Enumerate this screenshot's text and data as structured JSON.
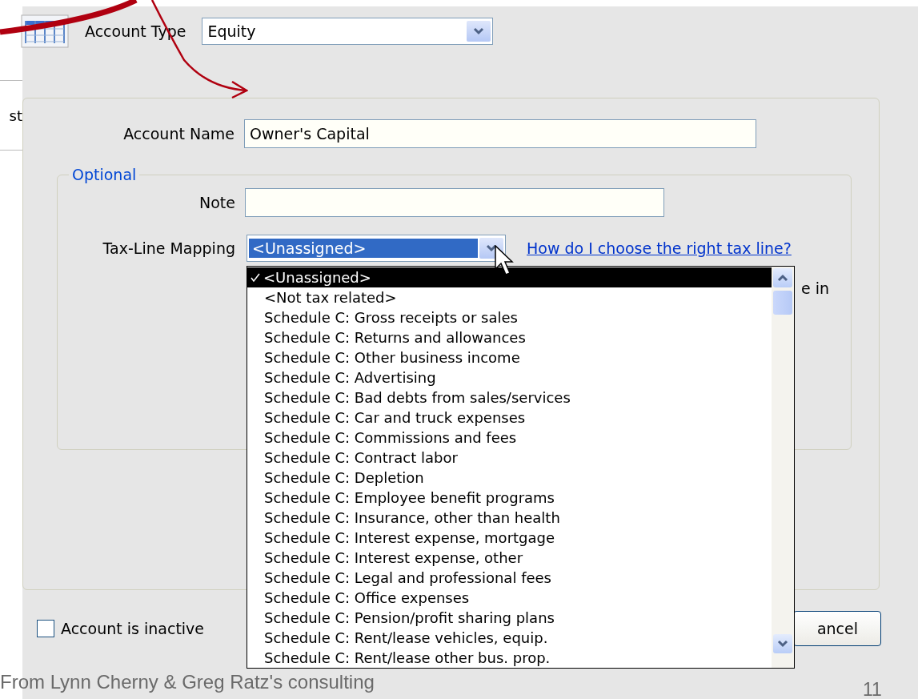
{
  "background_window": {
    "fragment": "st"
  },
  "account_type": {
    "label": "Account Type",
    "value": "Equity"
  },
  "account_name": {
    "label": "Account Name",
    "value": "Owner's Capital"
  },
  "optional": {
    "legend": "Optional",
    "note": {
      "label": "Note"
    },
    "tax_line": {
      "label": "Tax-Line Mapping",
      "value": "<Unassigned>",
      "expanded": true,
      "help_link": "How do I choose the right tax line?",
      "hidden_text": "e in"
    }
  },
  "tax_line_options": [
    {
      "label": "<Unassigned>",
      "selected": true
    },
    {
      "label": "<Not tax related>",
      "selected": false
    },
    {
      "label": "Schedule C: Gross receipts or sales",
      "selected": false
    },
    {
      "label": "Schedule C: Returns and allowances",
      "selected": false
    },
    {
      "label": "Schedule C: Other business income",
      "selected": false
    },
    {
      "label": "Schedule C: Advertising",
      "selected": false
    },
    {
      "label": "Schedule C: Bad debts from sales/services",
      "selected": false
    },
    {
      "label": "Schedule C: Car and truck expenses",
      "selected": false
    },
    {
      "label": "Schedule C: Commissions and fees",
      "selected": false
    },
    {
      "label": "Schedule C: Contract labor",
      "selected": false
    },
    {
      "label": "Schedule C: Depletion",
      "selected": false
    },
    {
      "label": "Schedule C: Employee benefit programs",
      "selected": false
    },
    {
      "label": "Schedule C: Insurance, other than health",
      "selected": false
    },
    {
      "label": "Schedule C: Interest expense, mortgage",
      "selected": false
    },
    {
      "label": "Schedule C: Interest expense, other",
      "selected": false
    },
    {
      "label": "Schedule C: Legal and professional fees",
      "selected": false
    },
    {
      "label": "Schedule C: Office expenses",
      "selected": false
    },
    {
      "label": "Schedule C: Pension/profit sharing plans",
      "selected": false
    },
    {
      "label": "Schedule C: Rent/lease vehicles, equip.",
      "selected": false
    },
    {
      "label": "Schedule C: Rent/lease other bus. prop.",
      "selected": false
    }
  ],
  "inactive": {
    "label": "Account is inactive",
    "checked": false
  },
  "cancel_button": "ancel",
  "slide": {
    "caption": "From Lynn Cherny & Greg Ratz's consulting",
    "page_number": "11"
  }
}
